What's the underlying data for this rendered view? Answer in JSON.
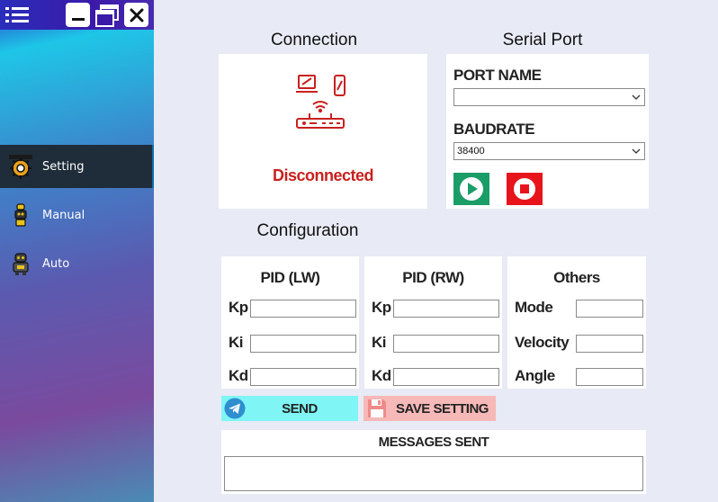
{
  "window": {
    "menu_icon": "hamburger-menu-icon",
    "controls": [
      "minimize-icon",
      "restore-icon",
      "close-icon"
    ]
  },
  "sidebar": {
    "items": [
      {
        "label": "Setting",
        "icon": "gear-icon",
        "active": true
      },
      {
        "label": "Manual",
        "icon": "robot-manual-icon",
        "active": false
      },
      {
        "label": "Auto",
        "icon": "robot-auto-icon",
        "active": false
      }
    ]
  },
  "connection": {
    "heading": "Connection",
    "icon": "network-devices-icon",
    "status": "Disconnected",
    "status_color": "#c8201f"
  },
  "serial_port": {
    "heading": "Serial Port",
    "port_label": "PORT NAME",
    "port_value": "",
    "baud_label": "BAUDRATE",
    "baud_value": "38400",
    "start_icon": "play-icon",
    "stop_icon": "stop-icon",
    "start_color": "#1b9d67",
    "stop_color": "#e8141c"
  },
  "configuration": {
    "heading": "Configuration",
    "pid_lw": {
      "title": "PID (LW)",
      "rows": [
        "Kp",
        "Ki",
        "Kd"
      ]
    },
    "pid_rw": {
      "title": "PID (RW)",
      "rows": [
        "Kp",
        "Ki",
        "Kd"
      ]
    },
    "others": {
      "title": "Others",
      "rows": [
        "Mode",
        "Velocity",
        "Angle"
      ]
    }
  },
  "buttons": {
    "send_label": "SEND",
    "send_icon": "telegram-send-icon",
    "send_color": "#7ff5f5",
    "save_label": "SAVE SETTING",
    "save_icon": "floppy-disk-icon",
    "save_color": "#f7b8b8"
  },
  "messages": {
    "title": "MESSAGES SENT",
    "value": ""
  }
}
